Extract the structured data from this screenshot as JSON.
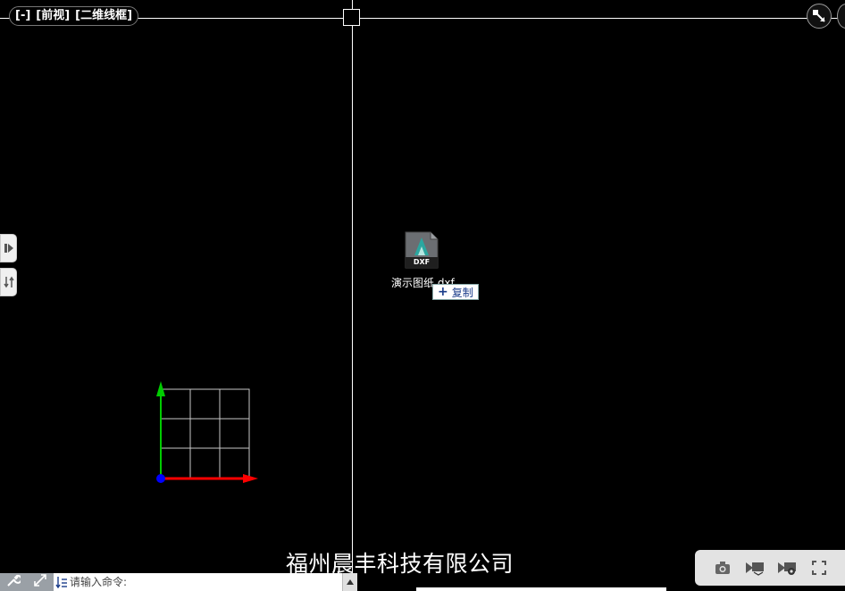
{
  "viewport": {
    "view_controls": [
      "[-]",
      "[前视]",
      "[二维线框]"
    ],
    "background_color": "#000000"
  },
  "drag_preview": {
    "file_icon_label": "DXF",
    "file_name": "演示图纸.dxf",
    "drop_action": "复制",
    "drop_action_icon": "plus-icon"
  },
  "side_tabs": [
    {
      "icon": "panel-toggle-icon"
    },
    {
      "icon": "swap-icon"
    }
  ],
  "ucs": {
    "x_color": "#ff0000",
    "y_color": "#00cc00",
    "origin_color": "#0000ff"
  },
  "watermark": {
    "company": "福州晨丰科技有限公司"
  },
  "command_line": {
    "tools": [
      "wrench-icon",
      "expand-icon"
    ],
    "prompt_icon": "command-list-icon",
    "placeholder": "请输入命令:",
    "scroll_icon": "caret-up-icon"
  },
  "status_tray": {
    "icons": [
      "camera-icon",
      "layer-visibility-icon",
      "settings-icon",
      "fullscreen-icon"
    ]
  }
}
